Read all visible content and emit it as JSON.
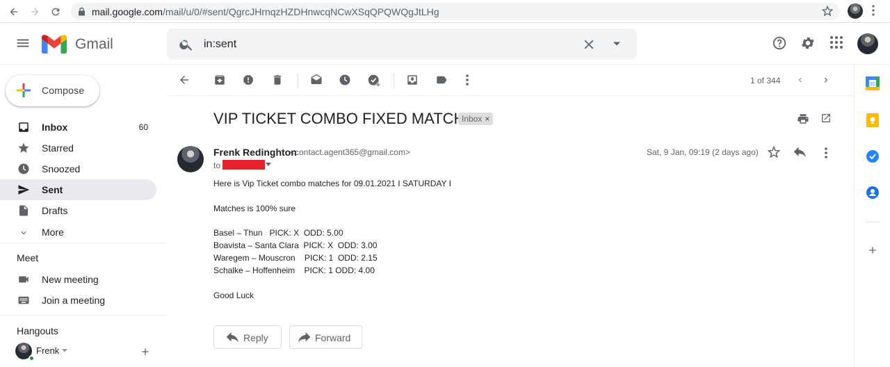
{
  "browser": {
    "url_host": "mail.google.com",
    "url_path": "/mail/u/0/#sent/QgrcJHrnqzHZDHnwcqNCwXSqQPQWQgJtLHg"
  },
  "header": {
    "app_name": "Gmail",
    "search_query": "in:sent"
  },
  "sidebar": {
    "compose_label": "Compose",
    "items": [
      {
        "label": "Inbox",
        "count": "60",
        "icon": "inbox-icon"
      },
      {
        "label": "Starred",
        "icon": "star-icon"
      },
      {
        "label": "Snoozed",
        "icon": "clock-icon"
      },
      {
        "label": "Sent",
        "icon": "send-icon"
      },
      {
        "label": "Drafts",
        "icon": "draft-icon"
      },
      {
        "label": "More",
        "icon": "chevron-down-icon"
      }
    ],
    "meet": {
      "title": "Meet",
      "items": [
        {
          "label": "New meeting",
          "icon": "video-icon"
        },
        {
          "label": "Join a meeting",
          "icon": "keyboard-icon"
        }
      ]
    },
    "hangouts": {
      "title": "Hangouts",
      "user": "Frenk"
    }
  },
  "toolbar": {
    "pager": "1 of 344"
  },
  "message": {
    "subject": "VIP TICKET COMBO FIXED MATCHES",
    "label_chip": "Inbox",
    "chip_close": "×",
    "sender_name": "Frenk Redinghton",
    "sender_email": "<contact.agent365@gmail.com>",
    "to_label": "to",
    "date": "Sat, 9 Jan, 09:19 (2 days ago)",
    "body": [
      "Here is Vip Ticket combo matches for 09.01.2021 I SATURDAY I",
      "Matches is 100% sure",
      "Basel – Thun   PICK: X  ODD: 5.00",
      "Boavista – Santa Clara  PICK: X  ODD: 3.00",
      "Waregem – Mouscron    PICK: 1  ODD: 2.15",
      "Schalke – Hoffenheim    PICK: 1 ODD: 4.00",
      "Good Luck"
    ],
    "reply_label": "Reply",
    "forward_label": "Forward"
  },
  "colors": {
    "accent_blue": "#1a73e8",
    "active_nav_bg": "#e8eaed",
    "redaction": "#e8202a",
    "icon_gray": "#5f6368"
  }
}
